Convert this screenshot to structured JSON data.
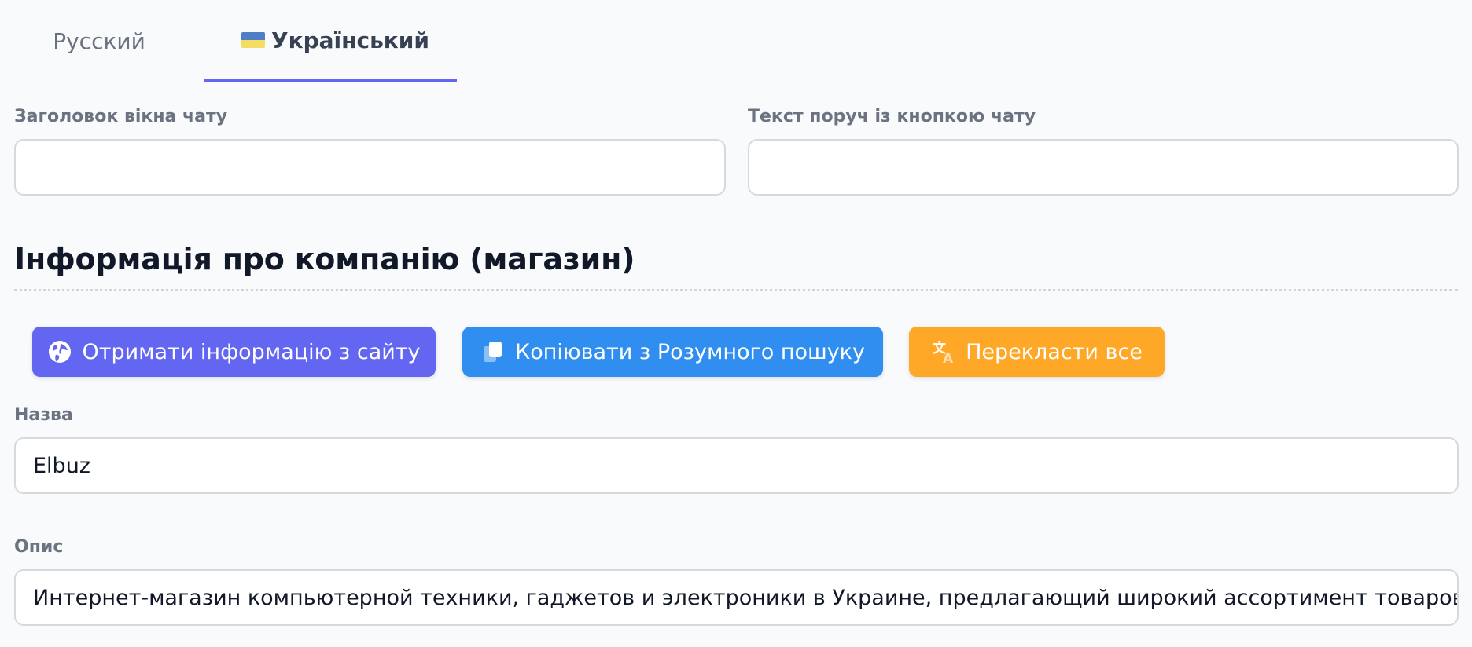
{
  "tabs": [
    {
      "label": "Русский",
      "active": false
    },
    {
      "label": "Український",
      "active": true
    }
  ],
  "chat": {
    "window_title_label": "Заголовок вікна чату",
    "window_title_value": "",
    "button_text_label": "Текст поруч із кнопкою чату",
    "button_text_value": ""
  },
  "company": {
    "section_title": "Інформація про компанію (магазин)",
    "buttons": {
      "fetch_site": "Отримати інформацію з сайту",
      "copy_smart_search": "Копіювати з Розумного пошуку",
      "translate_all": "Перекласти все"
    },
    "name_label": "Назва",
    "name_value": "Elbuz",
    "description_label": "Опис",
    "description_value": "Интернет-магазин компьютерной техники, гаджетов и электроники в Украине, предлагающий широкий ассортимент товаров: компьютеры, ноутбуки, комплектующие"
  },
  "colors": {
    "accent": "#6366f1",
    "copy_button": "#2f8ef0",
    "translate_button": "#ffa726"
  },
  "icons": {
    "flag": "ukraine-flag-icon",
    "fetch_site": "globe-icon",
    "copy": "copy-icon",
    "translate": "translate-icon"
  }
}
